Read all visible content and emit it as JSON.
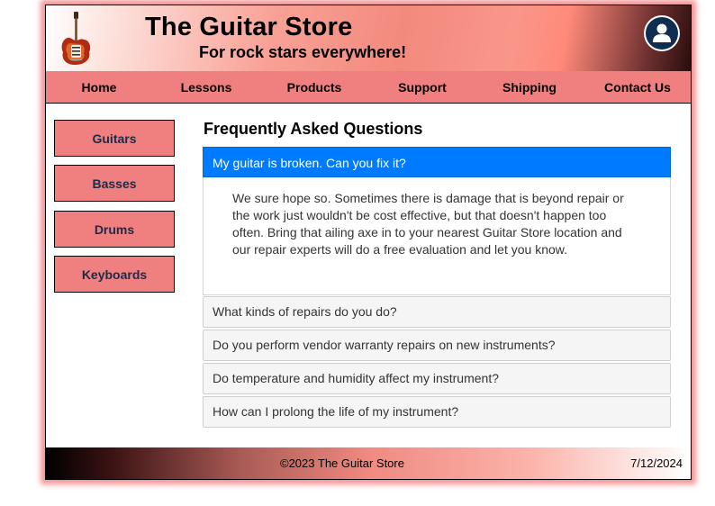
{
  "header": {
    "title": "The Guitar Store",
    "tagline": "For rock stars everywhere!",
    "logo_icon": "electric-guitar-icon",
    "account_icon": "user-icon"
  },
  "nav": {
    "items": [
      {
        "label": "Home"
      },
      {
        "label": "Lessons"
      },
      {
        "label": "Products"
      },
      {
        "label": "Support"
      },
      {
        "label": "Shipping"
      },
      {
        "label": "Contact Us"
      }
    ]
  },
  "sidebar": {
    "items": [
      {
        "label": "Guitars"
      },
      {
        "label": "Basses"
      },
      {
        "label": "Drums"
      },
      {
        "label": "Keyboards"
      }
    ]
  },
  "faq": {
    "title": "Frequently Asked Questions",
    "open_item": {
      "question": "My guitar is broken. Can you fix it?",
      "answer": "We sure hope so. Sometimes there is damage that is beyond repair or the work just wouldn't be cost effective, but that doesn't happen too often. Bring that ailing axe in to your nearest Guitar Store location and our repair experts will do a free evaluation and let you know."
    },
    "collapsed_items": [
      {
        "question": "What kinds of repairs do you do?"
      },
      {
        "question": "Do you perform vendor warranty repairs on new instruments?"
      },
      {
        "question": "Do temperature and humidity affect my instrument?"
      },
      {
        "question": "How can I prolong the life of my instrument?"
      }
    ]
  },
  "footer": {
    "copyright": "©2023 The Guitar Store",
    "date": "7/12/2024"
  },
  "colors": {
    "accent": "#f08080",
    "active_item": "#007bff",
    "account_circle": "#0f2d4f"
  }
}
